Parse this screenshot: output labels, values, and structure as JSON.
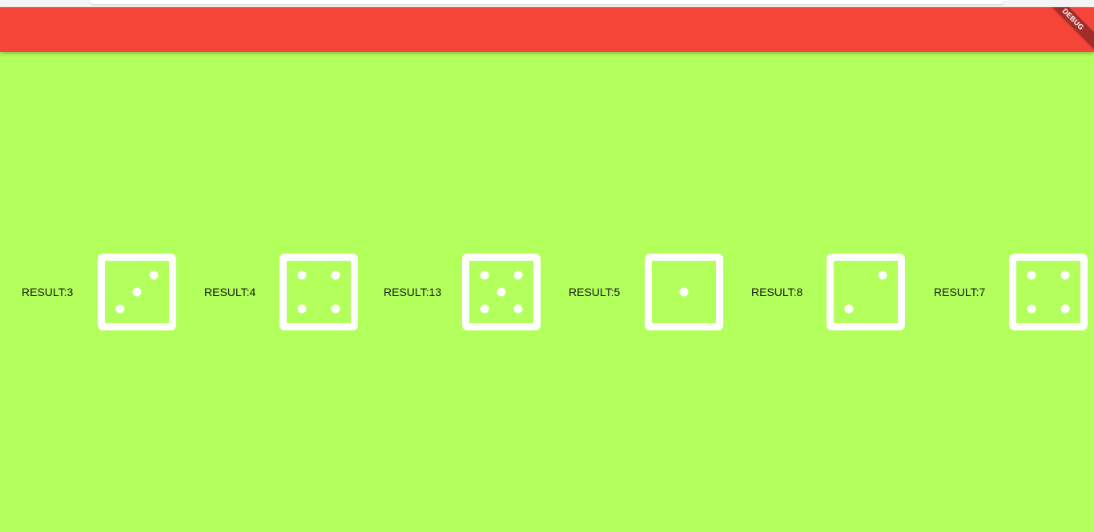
{
  "app_bar": {
    "color": "#f54539",
    "debug_label": "DEBUG"
  },
  "background_color": "#b3ff5b",
  "dice": [
    {
      "result_text": "RESULT:3",
      "face": 3
    },
    {
      "result_text": "RESULT:4",
      "face": 4
    },
    {
      "result_text": "RESULT:13",
      "face": 5
    },
    {
      "result_text": "RESULT:5",
      "face": 1
    },
    {
      "result_text": "RESULT:8",
      "face": 2
    },
    {
      "result_text": "RESULT:7",
      "face": 4
    }
  ]
}
